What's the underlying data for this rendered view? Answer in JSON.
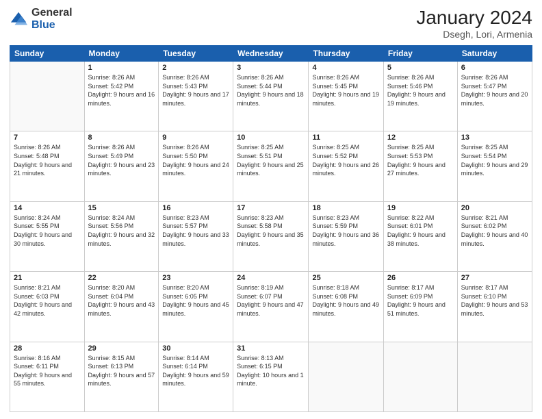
{
  "logo": {
    "general": "General",
    "blue": "Blue"
  },
  "header": {
    "title": "January 2024",
    "subtitle": "Dsegh, Lori, Armenia"
  },
  "weekdays": [
    "Sunday",
    "Monday",
    "Tuesday",
    "Wednesday",
    "Thursday",
    "Friday",
    "Saturday"
  ],
  "weeks": [
    [
      {
        "day": "",
        "sunrise": "",
        "sunset": "",
        "daylight": ""
      },
      {
        "day": "1",
        "sunrise": "Sunrise: 8:26 AM",
        "sunset": "Sunset: 5:42 PM",
        "daylight": "Daylight: 9 hours and 16 minutes."
      },
      {
        "day": "2",
        "sunrise": "Sunrise: 8:26 AM",
        "sunset": "Sunset: 5:43 PM",
        "daylight": "Daylight: 9 hours and 17 minutes."
      },
      {
        "day": "3",
        "sunrise": "Sunrise: 8:26 AM",
        "sunset": "Sunset: 5:44 PM",
        "daylight": "Daylight: 9 hours and 18 minutes."
      },
      {
        "day": "4",
        "sunrise": "Sunrise: 8:26 AM",
        "sunset": "Sunset: 5:45 PM",
        "daylight": "Daylight: 9 hours and 19 minutes."
      },
      {
        "day": "5",
        "sunrise": "Sunrise: 8:26 AM",
        "sunset": "Sunset: 5:46 PM",
        "daylight": "Daylight: 9 hours and 19 minutes."
      },
      {
        "day": "6",
        "sunrise": "Sunrise: 8:26 AM",
        "sunset": "Sunset: 5:47 PM",
        "daylight": "Daylight: 9 hours and 20 minutes."
      }
    ],
    [
      {
        "day": "7",
        "sunrise": "Sunrise: 8:26 AM",
        "sunset": "Sunset: 5:48 PM",
        "daylight": "Daylight: 9 hours and 21 minutes."
      },
      {
        "day": "8",
        "sunrise": "Sunrise: 8:26 AM",
        "sunset": "Sunset: 5:49 PM",
        "daylight": "Daylight: 9 hours and 23 minutes."
      },
      {
        "day": "9",
        "sunrise": "Sunrise: 8:26 AM",
        "sunset": "Sunset: 5:50 PM",
        "daylight": "Daylight: 9 hours and 24 minutes."
      },
      {
        "day": "10",
        "sunrise": "Sunrise: 8:25 AM",
        "sunset": "Sunset: 5:51 PM",
        "daylight": "Daylight: 9 hours and 25 minutes."
      },
      {
        "day": "11",
        "sunrise": "Sunrise: 8:25 AM",
        "sunset": "Sunset: 5:52 PM",
        "daylight": "Daylight: 9 hours and 26 minutes."
      },
      {
        "day": "12",
        "sunrise": "Sunrise: 8:25 AM",
        "sunset": "Sunset: 5:53 PM",
        "daylight": "Daylight: 9 hours and 27 minutes."
      },
      {
        "day": "13",
        "sunrise": "Sunrise: 8:25 AM",
        "sunset": "Sunset: 5:54 PM",
        "daylight": "Daylight: 9 hours and 29 minutes."
      }
    ],
    [
      {
        "day": "14",
        "sunrise": "Sunrise: 8:24 AM",
        "sunset": "Sunset: 5:55 PM",
        "daylight": "Daylight: 9 hours and 30 minutes."
      },
      {
        "day": "15",
        "sunrise": "Sunrise: 8:24 AM",
        "sunset": "Sunset: 5:56 PM",
        "daylight": "Daylight: 9 hours and 32 minutes."
      },
      {
        "day": "16",
        "sunrise": "Sunrise: 8:23 AM",
        "sunset": "Sunset: 5:57 PM",
        "daylight": "Daylight: 9 hours and 33 minutes."
      },
      {
        "day": "17",
        "sunrise": "Sunrise: 8:23 AM",
        "sunset": "Sunset: 5:58 PM",
        "daylight": "Daylight: 9 hours and 35 minutes."
      },
      {
        "day": "18",
        "sunrise": "Sunrise: 8:23 AM",
        "sunset": "Sunset: 5:59 PM",
        "daylight": "Daylight: 9 hours and 36 minutes."
      },
      {
        "day": "19",
        "sunrise": "Sunrise: 8:22 AM",
        "sunset": "Sunset: 6:01 PM",
        "daylight": "Daylight: 9 hours and 38 minutes."
      },
      {
        "day": "20",
        "sunrise": "Sunrise: 8:21 AM",
        "sunset": "Sunset: 6:02 PM",
        "daylight": "Daylight: 9 hours and 40 minutes."
      }
    ],
    [
      {
        "day": "21",
        "sunrise": "Sunrise: 8:21 AM",
        "sunset": "Sunset: 6:03 PM",
        "daylight": "Daylight: 9 hours and 42 minutes."
      },
      {
        "day": "22",
        "sunrise": "Sunrise: 8:20 AM",
        "sunset": "Sunset: 6:04 PM",
        "daylight": "Daylight: 9 hours and 43 minutes."
      },
      {
        "day": "23",
        "sunrise": "Sunrise: 8:20 AM",
        "sunset": "Sunset: 6:05 PM",
        "daylight": "Daylight: 9 hours and 45 minutes."
      },
      {
        "day": "24",
        "sunrise": "Sunrise: 8:19 AM",
        "sunset": "Sunset: 6:07 PM",
        "daylight": "Daylight: 9 hours and 47 minutes."
      },
      {
        "day": "25",
        "sunrise": "Sunrise: 8:18 AM",
        "sunset": "Sunset: 6:08 PM",
        "daylight": "Daylight: 9 hours and 49 minutes."
      },
      {
        "day": "26",
        "sunrise": "Sunrise: 8:17 AM",
        "sunset": "Sunset: 6:09 PM",
        "daylight": "Daylight: 9 hours and 51 minutes."
      },
      {
        "day": "27",
        "sunrise": "Sunrise: 8:17 AM",
        "sunset": "Sunset: 6:10 PM",
        "daylight": "Daylight: 9 hours and 53 minutes."
      }
    ],
    [
      {
        "day": "28",
        "sunrise": "Sunrise: 8:16 AM",
        "sunset": "Sunset: 6:11 PM",
        "daylight": "Daylight: 9 hours and 55 minutes."
      },
      {
        "day": "29",
        "sunrise": "Sunrise: 8:15 AM",
        "sunset": "Sunset: 6:13 PM",
        "daylight": "Daylight: 9 hours and 57 minutes."
      },
      {
        "day": "30",
        "sunrise": "Sunrise: 8:14 AM",
        "sunset": "Sunset: 6:14 PM",
        "daylight": "Daylight: 9 hours and 59 minutes."
      },
      {
        "day": "31",
        "sunrise": "Sunrise: 8:13 AM",
        "sunset": "Sunset: 6:15 PM",
        "daylight": "Daylight: 10 hours and 1 minute."
      },
      {
        "day": "",
        "sunrise": "",
        "sunset": "",
        "daylight": ""
      },
      {
        "day": "",
        "sunrise": "",
        "sunset": "",
        "daylight": ""
      },
      {
        "day": "",
        "sunrise": "",
        "sunset": "",
        "daylight": ""
      }
    ]
  ]
}
